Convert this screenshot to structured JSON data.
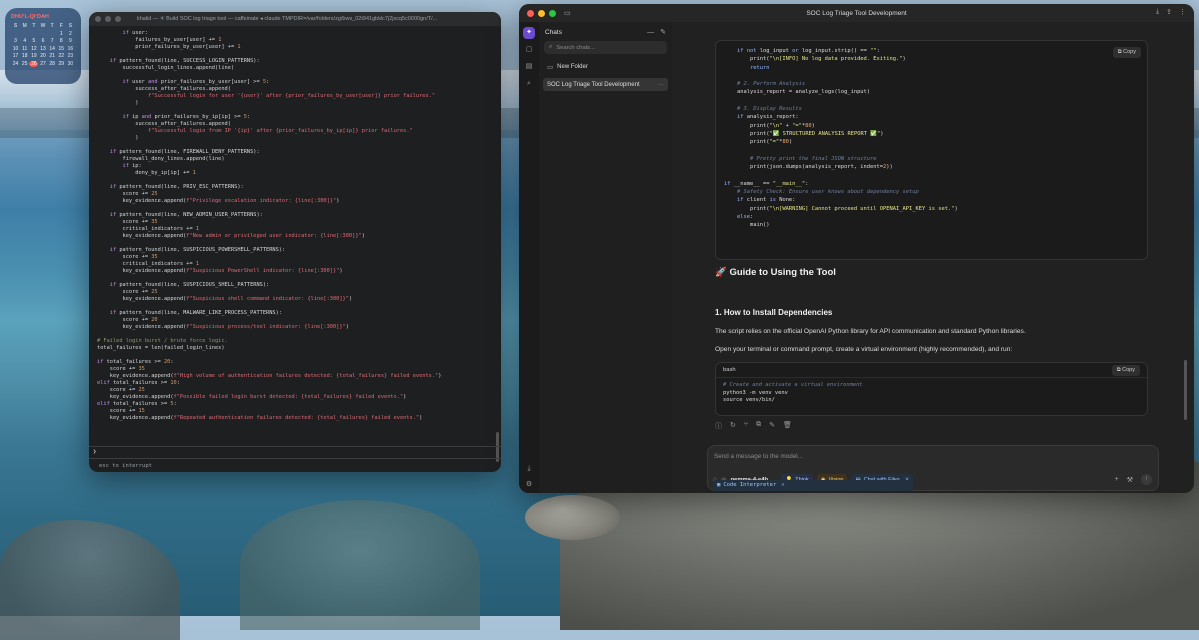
{
  "calendar": {
    "title": "DHUʻL-QIʻDAH",
    "dow": [
      "S",
      "M",
      "T",
      "W",
      "T",
      "F",
      "S"
    ],
    "days": [
      "",
      "",
      "",
      "",
      "",
      "1",
      "2",
      "3",
      "4",
      "5",
      "6",
      "7",
      "8",
      "9",
      "10",
      "11",
      "12",
      "13",
      "14",
      "15",
      "16",
      "17",
      "18",
      "19",
      "20",
      "21",
      "22",
      "23",
      "24",
      "25",
      "26",
      "27",
      "28",
      "29",
      "30"
    ],
    "today": "26"
  },
  "terminal": {
    "title": "khalid — ✳ Build SOC log triage tool — caffeinate ◂ claude TMPDIR=/var/folders/zg/bws_02t941gbklc7j2jxcq5c0000gn/T/...",
    "lines": [
      {
        "i": 0,
        "h": "        <span class='kw'>if</span> user:"
      },
      {
        "i": 1,
        "h": "            failures_by_user[user] += <span class='num'>1</span>"
      },
      {
        "i": 2,
        "h": "            prior_failures_by_user[user] += <span class='num'>1</span>"
      },
      {
        "i": 3,
        "h": ""
      },
      {
        "i": 4,
        "h": "    <span class='kw'>if</span> pattern_found(line, SUCCESS_LOGIN_PATTERNS):"
      },
      {
        "i": 5,
        "h": "        successful_login_lines.append(line)"
      },
      {
        "i": 6,
        "h": ""
      },
      {
        "i": 7,
        "h": "        <span class='kw'>if</span> user <span class='kw'>and</span> prior_failures_by_user[user] >= <span class='num'>5</span>:"
      },
      {
        "i": 8,
        "h": "            success_after_failures.append("
      },
      {
        "i": 9,
        "h": "                <span class='str'>f\"Successful login for user '{user}' after {prior_failures_by_user[user]} prior failures.\"</span>"
      },
      {
        "i": 10,
        "h": "            )"
      },
      {
        "i": 11,
        "h": ""
      },
      {
        "i": 12,
        "h": "        <span class='kw'>if</span> ip <span class='kw'>and</span> prior_failures_by_ip[ip] >= <span class='num'>5</span>:"
      },
      {
        "i": 13,
        "h": "            success_after_failures.append("
      },
      {
        "i": 14,
        "h": "                <span class='str'>f\"Successful login from IP '{ip}' after {prior_failures_by_ip[ip]} prior failures.\"</span>"
      },
      {
        "i": 15,
        "h": "            )"
      },
      {
        "i": 16,
        "h": ""
      },
      {
        "i": 17,
        "h": "    <span class='kw'>if</span> pattern_found(line, FIREWALL_DENY_PATTERNS):"
      },
      {
        "i": 18,
        "h": "        firewall_deny_lines.append(line)"
      },
      {
        "i": 19,
        "h": "        <span class='kw'>if</span> ip:"
      },
      {
        "i": 20,
        "h": "            deny_by_ip[ip] += <span class='num'>1</span>"
      },
      {
        "i": 21,
        "h": ""
      },
      {
        "i": 22,
        "h": "    <span class='kw'>if</span> pattern_found(line, PRIV_ESC_PATTERNS):"
      },
      {
        "i": 23,
        "h": "        score += <span class='num'>25</span>"
      },
      {
        "i": 24,
        "h": "        key_evidence.append(<span class='str'>f\"Privilege escalation indicator: {line[:300]}\"</span>)"
      },
      {
        "i": 25,
        "h": ""
      },
      {
        "i": 26,
        "h": "    <span class='kw'>if</span> pattern_found(line, NEW_ADMIN_USER_PATTERNS):"
      },
      {
        "i": 27,
        "h": "        score += <span class='num'>35</span>"
      },
      {
        "i": 28,
        "h": "        critical_indicators += <span class='num'>1</span>"
      },
      {
        "i": 29,
        "h": "        key_evidence.append(<span class='str'>f\"New admin or privileged user indicator: {line[:300]}\"</span>)"
      },
      {
        "i": 30,
        "h": ""
      },
      {
        "i": 31,
        "h": "    <span class='kw'>if</span> pattern_found(line, SUSPICIOUS_POWERSHELL_PATTERNS):"
      },
      {
        "i": 32,
        "h": "        score += <span class='num'>35</span>"
      },
      {
        "i": 33,
        "h": "        critical_indicators += <span class='num'>1</span>"
      },
      {
        "i": 34,
        "h": "        key_evidence.append(<span class='str'>f\"Suspicious PowerShell indicator: {line[:300]}\"</span>)"
      },
      {
        "i": 35,
        "h": ""
      },
      {
        "i": 36,
        "h": "    <span class='kw'>if</span> pattern_found(line, SUSPICIOUS_SHELL_PATTERNS):"
      },
      {
        "i": 37,
        "h": "        score += <span class='num'>25</span>"
      },
      {
        "i": 38,
        "h": "        key_evidence.append(<span class='str'>f\"Suspicious shell command indicator: {line[:300]}\"</span>)"
      },
      {
        "i": 39,
        "h": ""
      },
      {
        "i": 40,
        "h": "    <span class='kw'>if</span> pattern_found(line, MALWARE_LIKE_PROCESS_PATTERNS):"
      },
      {
        "i": 41,
        "h": "        score += <span class='num'>20</span>"
      },
      {
        "i": 42,
        "h": "        key_evidence.append(<span class='str'>f\"Suspicious process/tool indicator: {line[:300]}\"</span>)"
      },
      {
        "i": 43,
        "h": ""
      },
      {
        "i": 44,
        "h": "<span class='cmt'># Failed login burst / brute force logic.</span>"
      },
      {
        "i": 45,
        "h": "total_failures = len(failed_login_lines)"
      },
      {
        "i": 46,
        "h": ""
      },
      {
        "i": 47,
        "h": "<span class='kw'>if</span> total_failures >= <span class='num'>20</span>:"
      },
      {
        "i": 48,
        "h": "    score += <span class='num'>35</span>"
      },
      {
        "i": 49,
        "h": "    key_evidence.append(<span class='str'>f\"High volume of authentication failures detected: {total_failures} failed events.\"</span>)"
      },
      {
        "i": 50,
        "h": "<span class='kw'>elif</span> total_failures >= <span class='num'>10</span>:"
      },
      {
        "i": 51,
        "h": "    score += <span class='num'>25</span>"
      },
      {
        "i": 52,
        "h": "    key_evidence.append(<span class='str'>f\"Possible failed login burst detected: {total_failures} failed events.\"</span>)"
      },
      {
        "i": 53,
        "h": "<span class='kw'>elif</span> total_failures >= <span class='num'>5</span>:"
      },
      {
        "i": 54,
        "h": "    score += <span class='num'>15</span>"
      },
      {
        "i": 55,
        "h": "    key_evidence.append(<span class='str'>f\"Repeated authentication failures detected: {total_failures} failed events.\"</span>)"
      }
    ],
    "prompt": "❯",
    "footer": "esc to interrupt"
  },
  "app": {
    "title": "SOC Log Triage Tool Development",
    "sidebar": {
      "heading": "Chats",
      "search_placeholder": "Search chats...",
      "new_folder": "New Folder",
      "active_chat": "SOC Log Triage Tool Development",
      "more": "···"
    },
    "code_copy": "Copy",
    "code_lines": [
      "    <span class='gk'>if not</span> log_input <span class='gk'>or</span> log_input.strip() == <span class='gs'>\"\"</span>:",
      "        print(<span class='gs'>\"\\n[INFO] No log data provided. Exiting.\"</span>)",
      "        <span class='gk'>return</span>",
      "",
      "    <span class='gc'># 2. Perform Analysis</span>",
      "    analysis_report = analyze_logs(log_input)",
      "",
      "    <span class='gc'># 3. Display Results</span>",
      "    <span class='gk'>if</span> analysis_report:",
      "        print(<span class='gs'>\"\\n\"</span> + <span class='gs'>\"=\"</span>*<span class='gn'>80</span>)",
      "        print(<span class='gs'>\"✅ STRUCTURED ANALYSIS REPORT ✅\"</span>)",
      "        print(<span class='gs'>\"=\"</span>*<span class='gn'>80</span>)",
      "",
      "        <span class='gc'># Pretty print the final JSON structure</span>",
      "        print(json.dumps(analysis_report, indent=<span class='gn'>2</span>))",
      "",
      "<span class='gk'>if</span> __name__ == <span class='gs'>\"__main__\"</span>:",
      "    <span class='gc'># Safety Check: Ensure user knows about dependency setup</span>",
      "    <span class='gk'>if</span> client <span class='gk'>is</span> None:",
      "        print(<span class='gs'>\"\\n[WARNING] Cannot proceed until OPENAI_API_KEY is set.\"</span>)",
      "    <span class='gk'>else</span>:",
      "        main()"
    ],
    "guide_heading": "🚀 Guide to Using the Tool",
    "section_heading": "1. How to Install Dependencies",
    "para1": "The script relies on the official OpenAI Python library for API communication and standard Python libraries.",
    "para2": "Open your terminal or command prompt, create a virtual environment (highly recommended), and run:",
    "bash_label": "bash",
    "bash_copy": "Copy",
    "bash_lines": [
      "<span class='gc'># Create and activate a virtual environment</span>",
      "python3 -m venv venv",
      "source venv/bin/"
    ],
    "composer_placeholder": "Send a message to the model...",
    "model": "gemma-4-e4b",
    "chips": {
      "think": "Think",
      "vision": "Vision",
      "code": "Code Interpreter",
      "files": "Chat with Files"
    }
  }
}
